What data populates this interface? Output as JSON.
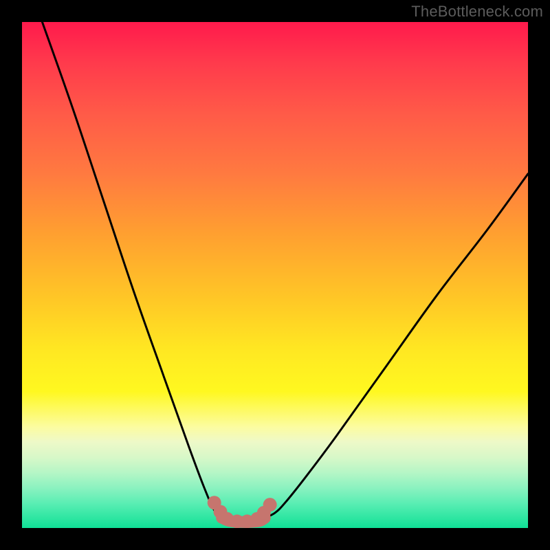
{
  "watermark": "TheBottleneck.com",
  "chart_data": {
    "type": "line",
    "title": "",
    "xlabel": "",
    "ylabel": "",
    "xlim": [
      0,
      100
    ],
    "ylim": [
      0,
      100
    ],
    "series": [
      {
        "name": "curve-left",
        "x": [
          4,
          10,
          16,
          22,
          28,
          33,
          36,
          38,
          39.5
        ],
        "values": [
          100,
          83,
          65,
          47,
          30,
          16,
          8,
          3.5,
          2
        ]
      },
      {
        "name": "curve-right",
        "x": [
          48,
          50,
          52,
          56,
          62,
          72,
          82,
          92,
          100
        ],
        "values": [
          2,
          3,
          5,
          10,
          18,
          32,
          46,
          59,
          70
        ]
      },
      {
        "name": "valley-floor",
        "x": [
          39.5,
          41,
          43,
          45,
          47,
          48
        ],
        "values": [
          2,
          1.4,
          1.2,
          1.2,
          1.4,
          2
        ]
      }
    ],
    "markers": {
      "name": "valley-markers",
      "color": "#c6756e",
      "points": [
        {
          "x": 38.0,
          "y": 5.0
        },
        {
          "x": 39.2,
          "y": 3.2
        },
        {
          "x": 40.5,
          "y": 1.8
        },
        {
          "x": 42.5,
          "y": 1.3
        },
        {
          "x": 44.5,
          "y": 1.3
        },
        {
          "x": 46.5,
          "y": 1.8
        },
        {
          "x": 47.8,
          "y": 3.0
        },
        {
          "x": 49.0,
          "y": 4.6
        }
      ]
    },
    "note": "Axis values are in percent of plot width/height; no numeric tick labels are visible on the chart."
  }
}
